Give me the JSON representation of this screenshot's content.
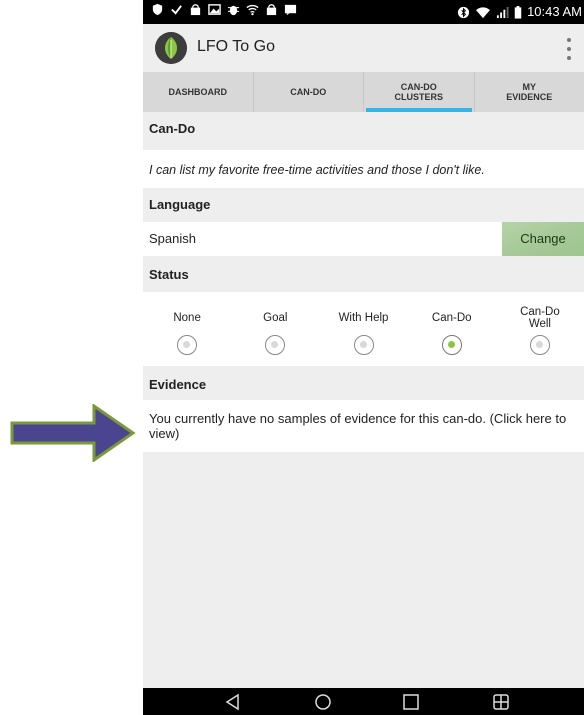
{
  "status_bar": {
    "time": "10:43 AM",
    "left_icons": [
      "shield-icon",
      "check-icon",
      "store-icon",
      "image-icon",
      "bug-icon",
      "wifi-icon",
      "store-icon",
      "message-icon"
    ],
    "right_icons": [
      "bluetooth-icon",
      "wifi-icon",
      "signal-icon",
      "battery-icon"
    ]
  },
  "app": {
    "title": "LFO To Go",
    "logo": "leaf-logo",
    "menu_icon": "overflow-menu-icon"
  },
  "tabs": [
    {
      "label": "DASHBOARD",
      "active": false
    },
    {
      "label": "CAN-DO",
      "active": false
    },
    {
      "label": "CAN-DO CLUSTERS",
      "active": true
    },
    {
      "label": "MY EVIDENCE",
      "active": false
    }
  ],
  "cando": {
    "header": "Can-Do",
    "text": "I can list my favorite free-time activities and those I don't like."
  },
  "language": {
    "header": "Language",
    "value": "Spanish",
    "change_label": "Change"
  },
  "status": {
    "header": "Status",
    "options": [
      {
        "label": "None",
        "checked": false
      },
      {
        "label": "Goal",
        "checked": false
      },
      {
        "label": "With Help",
        "checked": false
      },
      {
        "label": "Can-Do",
        "checked": true
      },
      {
        "label": "Can-Do Well",
        "checked": false
      }
    ]
  },
  "evidence": {
    "header": "Evidence",
    "text": "You currently have no samples of evidence for this can-do. (Click here to view)"
  },
  "nav": [
    "back-icon",
    "home-icon",
    "recent-apps-icon",
    "multi-window-icon"
  ],
  "colors": {
    "accent": "#33b5e5",
    "change_button": "#a4c896",
    "radio_selected": "#8cc63f",
    "arrow_fill": "#4b4590",
    "arrow_border": "#7a9a3a"
  }
}
